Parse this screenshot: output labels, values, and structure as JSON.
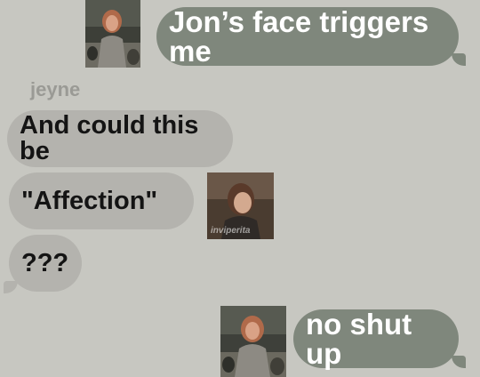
{
  "conversation": {
    "messages": [
      {
        "text": "Jon’s face triggers me",
        "direction": "outgoing"
      },
      {
        "text": "And could this be",
        "direction": "incoming"
      },
      {
        "text": "\"Affection\"",
        "direction": "incoming"
      },
      {
        "text": "???",
        "direction": "incoming"
      },
      {
        "text": "no shut up",
        "direction": "outgoing"
      }
    ],
    "sender_name": "jeyne",
    "sticker_watermark": "inviperita"
  },
  "icons": {
    "photo_1": "portrait-photo-icon",
    "photo_2": "portrait-photo-icon",
    "photo_3": "portrait-photo-icon"
  },
  "colors": {
    "background": "#c7c7c1",
    "outgoing_bubble": "#7f877c",
    "incoming_bubble": "#b4b3ae",
    "sender_name": "#9a9a95"
  }
}
